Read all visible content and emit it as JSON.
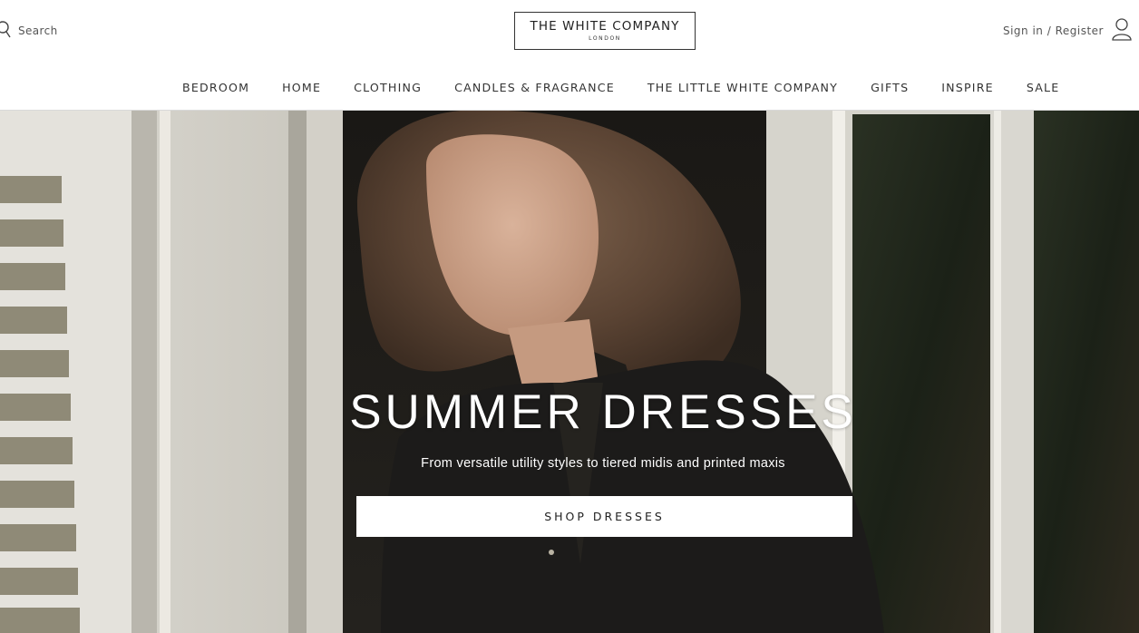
{
  "header": {
    "search_label": "Search",
    "logo_main": "THE WHITE COMPANY",
    "logo_sub": "LONDON",
    "account_label": "Sign in / Register"
  },
  "nav": {
    "items": [
      "BEDROOM",
      "HOME",
      "CLOTHING",
      "CANDLES & FRAGRANCE",
      "THE LITTLE WHITE COMPANY",
      "GIFTS",
      "INSPIRE",
      "SALE"
    ]
  },
  "hero": {
    "title": "SUMMER DRESSES",
    "subtitle": "From versatile utility styles to tiered midis and printed maxis",
    "cta_label": "SHOP DRESSES"
  },
  "icons": {
    "search": "search-icon",
    "account": "user-icon"
  },
  "colors": {
    "text": "#333333",
    "header_bg": "#ffffff",
    "cta_bg": "#ffffff",
    "hero_text": "#ffffff"
  }
}
